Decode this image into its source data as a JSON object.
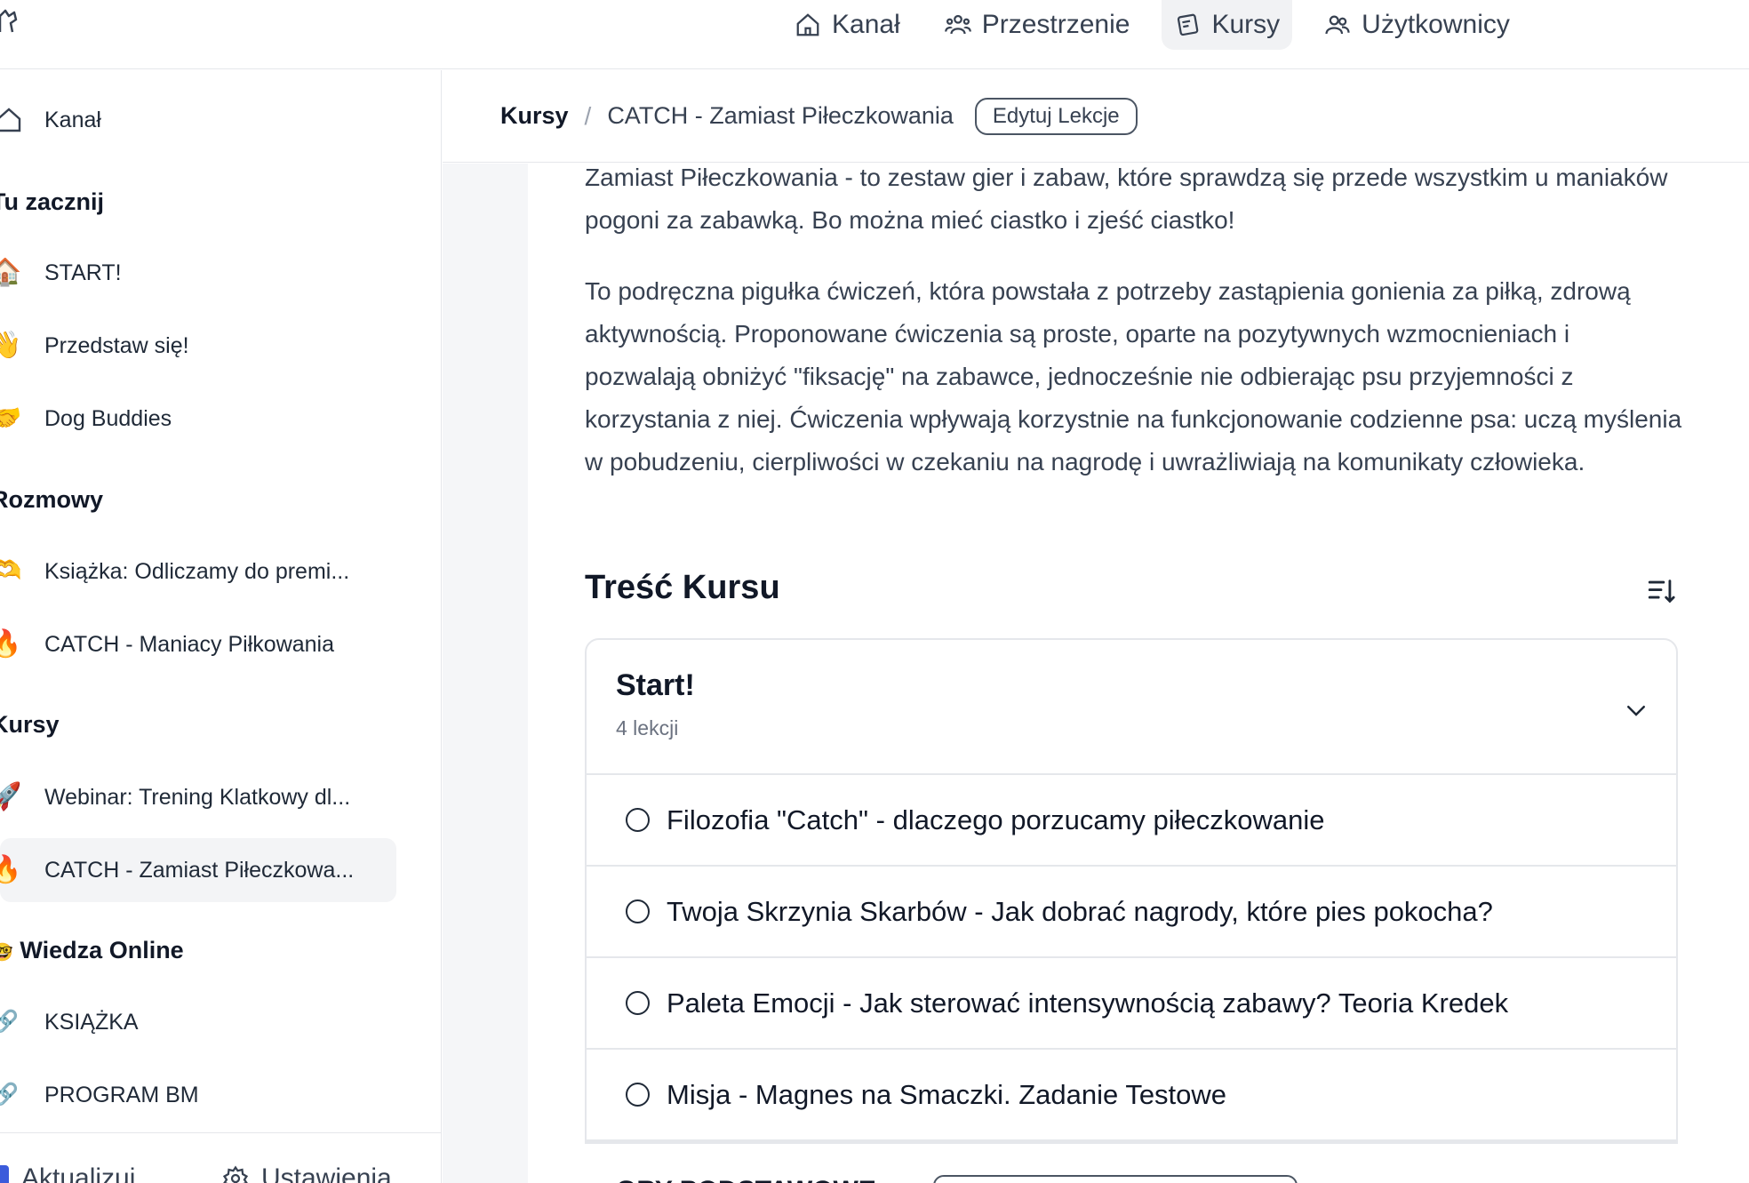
{
  "topnav": {
    "items": [
      {
        "label": "Kanał",
        "icon": "home-icon",
        "active": false
      },
      {
        "label": "Przestrzenie",
        "icon": "people-icon",
        "active": false
      },
      {
        "label": "Kursy",
        "icon": "courses-icon",
        "active": true
      },
      {
        "label": "Użytkownicy",
        "icon": "users-icon",
        "active": false
      }
    ]
  },
  "sidebar": {
    "feed": {
      "label": "Kanał",
      "icon": "home-icon"
    },
    "headings": {
      "start_here": "Tu zacznij",
      "conversations": "Rozmowy",
      "courses": "Kursy",
      "knowledge": "Wiedza Online",
      "knowledge_emoji": "🤓"
    },
    "start_items": [
      {
        "emoji": "🏠",
        "label": "START!"
      },
      {
        "emoji": "👋",
        "label": "Przedstaw się!"
      },
      {
        "emoji": "🤝",
        "label": "Dog Buddies"
      }
    ],
    "conversation_items": [
      {
        "emoji": "🫶",
        "label": "Książka: Odliczamy do premi..."
      },
      {
        "emoji": "🔥",
        "label": "CATCH - Maniacy Piłkowania"
      }
    ],
    "course_items": [
      {
        "emoji": "🚀",
        "label": "Webinar: Trening Klatkowy dl..."
      },
      {
        "emoji": "🔥",
        "label": "CATCH - Zamiast Piłeczkowa..."
      }
    ],
    "knowledge_items": [
      {
        "emoji": "🔗",
        "label": "KSIĄŻKA"
      },
      {
        "emoji": "🔗",
        "label": "PROGRAM BM"
      }
    ],
    "footer": {
      "update_label": "Aktualizuj",
      "settings_label": "Ustawienia"
    }
  },
  "breadcrumb": {
    "root": "Kursy",
    "separator": "/",
    "current": "CATCH - Zamiast Piłeczkowania",
    "edit_label": "Edytuj Lekcje"
  },
  "main": {
    "paragraph_1": "Zamiast Piłeczkowania - to zestaw gier i zabaw, które sprawdzą się przede wszystkim u maniaków pogoni za zabawką. Bo można mieć ciastko i zjeść ciastko!",
    "paragraph_2": "To podręczna pigułka ćwiczeń, która powstała z potrzeby zastąpienia gonienia za piłką, zdrową aktywnością. Proponowane ćwiczenia są proste, oparte na pozytywnych wzmocnieniach i pozwalają obniżyć \"fiksację\" na zabawce, jednocześnie nie odbierając psu przyjemności z korzystania z niej. Ćwiczenia wpływają korzystnie na funkcjonowanie codzienne psa: uczą myślenia w pobudzeniu, cierpliwości w czekaniu na nagrodę i uwrażliwiają na komunikaty człowieka.",
    "content_title": "Treść Kursu",
    "section": {
      "title": "Start!",
      "count": "4 lekcji",
      "lessons": [
        "Filozofia \"Catch\" - dlaczego porzucamy piłeczkowanie",
        "Twoja Skrzynia Skarbów - Jak dobrać nagrody, które pies pokocha?",
        "Paleta Emocji - Jak sterować intensywnością zabawy? Teoria Kredek",
        "Misja - Magnes na Smaczki. Zadanie Testowe"
      ]
    },
    "next_section_title": "GRY PODSTAWOWE"
  },
  "colors": {
    "active_nav_bg": "#f1f2f4",
    "main_bg": "#f5f6f8",
    "border": "#e5e7eb",
    "accent": "#3b5bdb"
  }
}
